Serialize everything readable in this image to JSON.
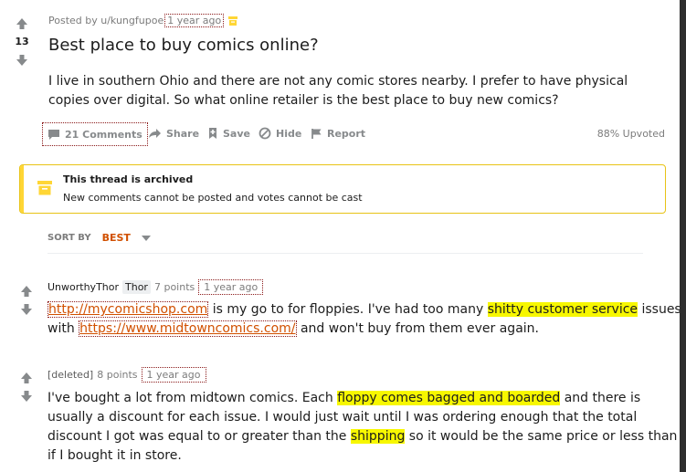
{
  "post": {
    "score": "13",
    "posted_by": "Posted by u/kungfupoe",
    "age": "1 year ago",
    "title": "Best place to buy comics online?",
    "body": "I live in southern Ohio and there are not any comic stores nearby. I prefer to have physical copies over digital. So what online retailer is the best place to buy new comics?",
    "actions": {
      "comments": "21 Comments",
      "share": "Share",
      "save": "Save",
      "hide": "Hide",
      "report": "Report"
    },
    "upvoted": "88% Upvoted"
  },
  "archived": {
    "title": "This thread is archived",
    "message": "New comments cannot be posted and votes cannot be cast"
  },
  "sort": {
    "label": "SORT BY",
    "value": "BEST"
  },
  "comments": [
    {
      "author": "UnworthyThor",
      "flair": "Thor",
      "points": "7 points",
      "age": "1 year ago",
      "link1": "http://mycomicshop.com",
      "text1": " is my go to for floppies. I've had too many ",
      "highlight1": "shitty customer service",
      "text2": " issues",
      "text3": "with ",
      "link2": "https://www.midtowncomics.com/",
      "text4": " and won't buy from them ever again."
    },
    {
      "author": "[deleted]",
      "points": "8 points",
      "age": "1 year ago",
      "text1": "I've bought a lot from midtown comics. Each ",
      "highlight1": "floppy comes bagged and boarded",
      "text2": " and there is",
      "text3": "usually a discount for each issue. I would just wait until I was ordering enough that the total",
      "text4": "discount I got was equal to or greater than the ",
      "highlight2": "shipping",
      "text5": " so it would be the same price or less than",
      "text6": "if I bought it in store."
    }
  ],
  "icons": [
    "upvote-icon",
    "downvote-icon",
    "archive-icon",
    "comment-icon",
    "share-icon",
    "save-icon",
    "hide-icon",
    "report-icon",
    "chevron-down-icon"
  ],
  "colors": {
    "accent": "#d15000",
    "archive_yellow": "#ffd635",
    "highlight": "#f7f700",
    "text": "#1c1c1c",
    "meta": "#7c7c7c"
  }
}
